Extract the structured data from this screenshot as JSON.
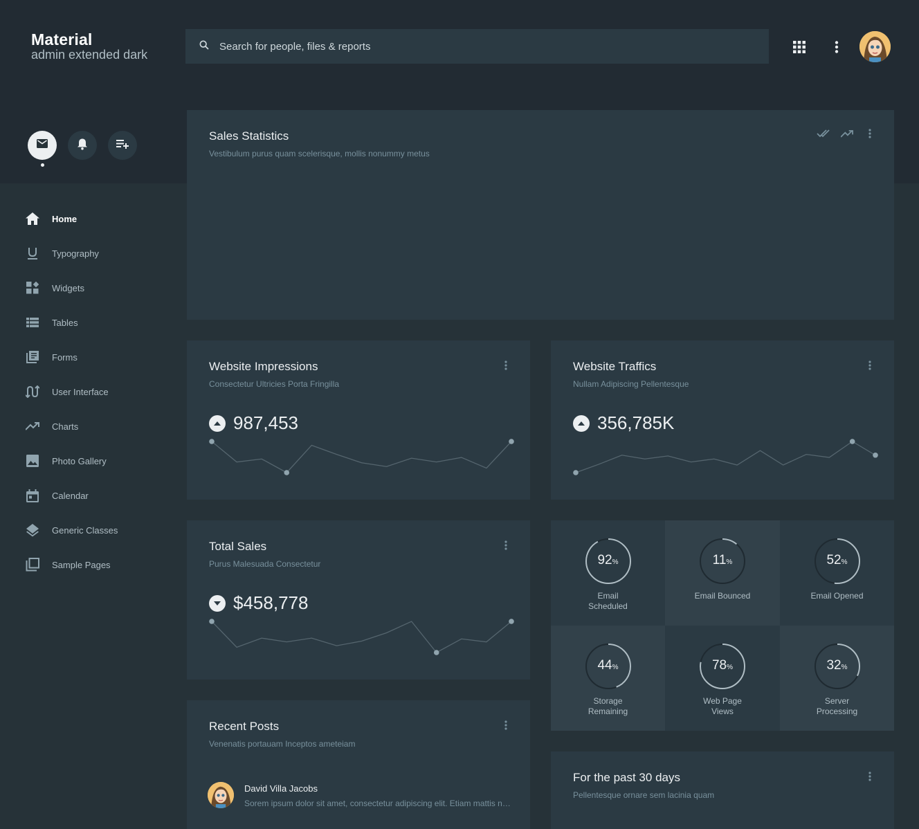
{
  "brand": {
    "name": "Material",
    "subtitle": "admin extended dark"
  },
  "search": {
    "placeholder": "Search for people, files & reports"
  },
  "header_icons": [
    "apps-grid-icon",
    "more-vertical-icon",
    "user-avatar"
  ],
  "quick_actions": [
    "mail-icon",
    "bell-icon",
    "playlist-add-icon"
  ],
  "sidebar": {
    "items": [
      {
        "label": "Home",
        "icon": "home-icon",
        "active": true
      },
      {
        "label": "Typography",
        "icon": "underline-icon"
      },
      {
        "label": "Widgets",
        "icon": "widgets-icon"
      },
      {
        "label": "Tables",
        "icon": "list-icon"
      },
      {
        "label": "Forms",
        "icon": "library-books-icon"
      },
      {
        "label": "User Interface",
        "icon": "interface-icon"
      },
      {
        "label": "Charts",
        "icon": "trending-up-icon"
      },
      {
        "label": "Photo Gallery",
        "icon": "image-icon"
      },
      {
        "label": "Calendar",
        "icon": "calendar-icon"
      },
      {
        "label": "Generic Classes",
        "icon": "layers-icon"
      },
      {
        "label": "Sample Pages",
        "icon": "pages-icon"
      }
    ]
  },
  "sales": {
    "title": "Sales Statistics",
    "subtitle": "Vestibulum purus quam scelerisque, mollis nonummy metus"
  },
  "impressions": {
    "title": "Website Impressions",
    "subtitle": "Consectetur Ultricies Porta Fringilla",
    "value": "987,453",
    "trend": "up",
    "spark": [
      45,
      18,
      22,
      4,
      40,
      28,
      17,
      12,
      23,
      18,
      24,
      10,
      45
    ]
  },
  "traffic": {
    "title": "Website Traffics",
    "subtitle": "Nullam Adipiscing Pellentesque",
    "value": "356,785K",
    "trend": "up",
    "spark": [
      4,
      15,
      27,
      22,
      26,
      18,
      22,
      14,
      33,
      14,
      28,
      24,
      45,
      27
    ]
  },
  "total_sales": {
    "title": "Total Sales",
    "subtitle": "Purus Malesuada Consectetur",
    "value": "$458,778",
    "trend": "down",
    "spark": [
      45,
      11,
      23,
      18,
      23,
      13,
      19,
      30,
      45,
      4,
      22,
      18,
      45
    ]
  },
  "stats": [
    {
      "value": "92",
      "unit": "%",
      "label": "Email Scheduled",
      "percent": 92,
      "tone": "dark"
    },
    {
      "value": "11",
      "unit": "%",
      "label": "Email Bounced",
      "percent": 11,
      "tone": "light"
    },
    {
      "value": "52",
      "unit": "%",
      "label": "Email Opened",
      "percent": 52,
      "tone": "dark"
    },
    {
      "value": "44",
      "unit": "%",
      "label": "Storage Remaining",
      "percent": 44,
      "tone": "light"
    },
    {
      "value": "78",
      "unit": "%",
      "label": "Web Page Views",
      "percent": 78,
      "tone": "dark"
    },
    {
      "value": "32",
      "unit": "%",
      "label": "Server Processing",
      "percent": 32,
      "tone": "light"
    }
  ],
  "recent_posts": {
    "title": "Recent Posts",
    "subtitle": "Venenatis portauam Inceptos ameteiam",
    "posts": [
      {
        "author": "David Villa Jacobs",
        "excerpt": "Sorem ipsum dolor sit amet, consectetur adipiscing elit. Etiam mattis neque ac"
      }
    ]
  },
  "past30": {
    "title": "For the past 30 days",
    "subtitle": "Pellentesque ornare sem lacinia quam"
  },
  "colors": {
    "background": "#263238",
    "card": "#2b3a43",
    "accent": "#eceff1",
    "muted": "#78909c"
  }
}
